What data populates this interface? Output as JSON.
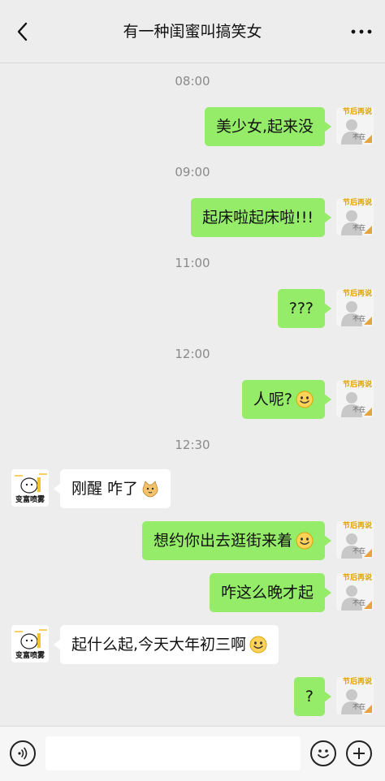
{
  "header": {
    "title": "有一种闺蜜叫搞笑女"
  },
  "avatars": {
    "me_top": "节后再说",
    "me_bottom": "不在",
    "them_label": "变富喷雾"
  },
  "messages": [
    {
      "type": "time",
      "text": "08:00"
    },
    {
      "type": "msg",
      "side": "me",
      "text": "美少女,起来没",
      "emoji": ""
    },
    {
      "type": "time",
      "text": "09:00"
    },
    {
      "type": "msg",
      "side": "me",
      "text": "起床啦起床啦!!!",
      "emoji": ""
    },
    {
      "type": "time",
      "text": "11:00"
    },
    {
      "type": "msg",
      "side": "me",
      "text": "???",
      "emoji": ""
    },
    {
      "type": "time",
      "text": "12:00"
    },
    {
      "type": "msg",
      "side": "me",
      "text": "人呢?",
      "emoji": "smile-emoji"
    },
    {
      "type": "time",
      "text": "12:30"
    },
    {
      "type": "msg",
      "side": "them",
      "text": "刚醒 咋了",
      "emoji": "cat-emoji"
    },
    {
      "type": "msg",
      "side": "me",
      "text": "想约你出去逛街来着",
      "emoji": "smile-emoji"
    },
    {
      "type": "msg",
      "side": "me",
      "text": "咋这么晚才起",
      "emoji": ""
    },
    {
      "type": "msg",
      "side": "them",
      "text": "起什么起,今天大年初三啊",
      "emoji": "smile-emoji"
    },
    {
      "type": "msg",
      "side": "me",
      "text": "?",
      "emoji": ""
    }
  ],
  "input": {
    "value": ""
  },
  "colors": {
    "me_bubble": "#95ec69",
    "them_bubble": "#ffffff",
    "background": "#ededed"
  }
}
